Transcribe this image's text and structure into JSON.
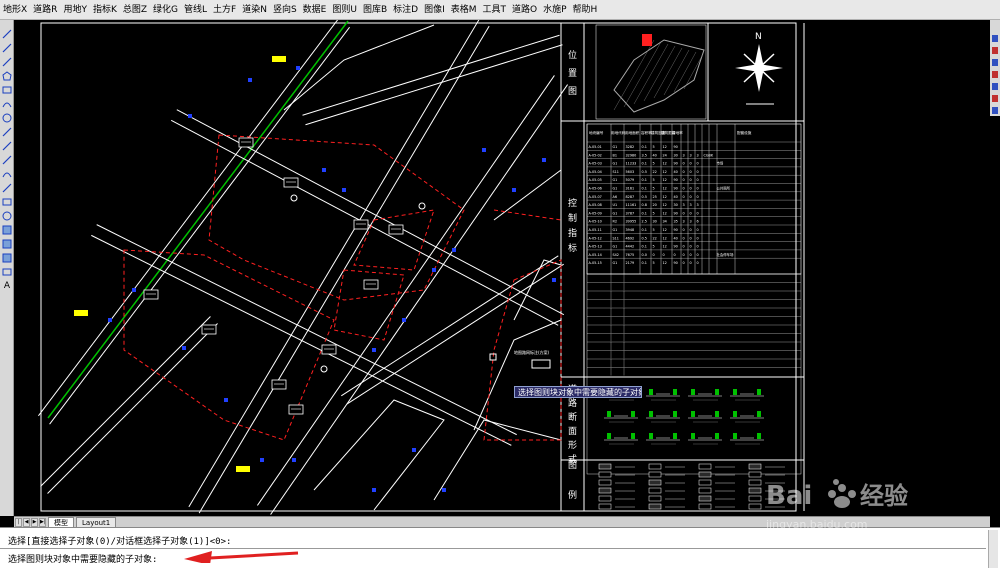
{
  "menu": {
    "items": [
      "地形X",
      "道路R",
      "用地Y",
      "指标K",
      "总图Z",
      "绿化G",
      "管线L",
      "土方F",
      "道染N",
      "竖向S",
      "数据E",
      "图则U",
      "图库B",
      "标注D",
      "图像I",
      "表格M",
      "工具T",
      "道路O",
      "水施P",
      "帮助H"
    ]
  },
  "drawing": {
    "map_titles": {
      "location": [
        "位",
        "置",
        "图"
      ],
      "indicators": [
        "控",
        "制",
        "指",
        "标"
      ],
      "road_section": [
        "道",
        "路",
        "断",
        "面",
        "形",
        "式"
      ],
      "legend": [
        "图",
        "例"
      ]
    },
    "north_label": "N",
    "table_headers": [
      "地块编号",
      "用地代码",
      "用地面积",
      "容积率",
      "建筑密度",
      "建筑限高",
      "绿地率",
      "配套设施"
    ],
    "table_rows": [
      [
        "A-05-01",
        "G1",
        "3282",
        "0.1",
        "5",
        "12",
        "90",
        "",
        ""
      ],
      [
        "A-05-02",
        "B1",
        "32980",
        "3.5",
        "40",
        "24",
        "30",
        "3",
        "3",
        "3",
        "CGBK",
        ""
      ],
      [
        "A-05-03",
        "G1",
        "11233",
        "0.1",
        "5",
        "12",
        "90",
        "0",
        "0",
        "0",
        "",
        "市场"
      ],
      [
        "A-05-04",
        "S11",
        "5603",
        "0.5",
        "22",
        "12",
        "40",
        "0",
        "0",
        "0",
        "",
        ""
      ],
      [
        "A-05-05",
        "G1",
        "5079",
        "0.1",
        "5",
        "12",
        "90",
        "0",
        "0",
        "0",
        "",
        ""
      ],
      [
        "A-05-06",
        "G1",
        "3161",
        "0.1",
        "5",
        "12",
        "90",
        "0",
        "0",
        "0",
        "",
        "公共厕所"
      ],
      [
        "A-05-07",
        "A6",
        "8287",
        "0.5",
        "25",
        "12",
        "40",
        "0",
        "0",
        "0",
        "",
        ""
      ],
      [
        "A-05-08",
        "U1",
        "11161",
        "0.8",
        "20",
        "12",
        "30",
        "3",
        "3",
        "3",
        "",
        ""
      ],
      [
        "A-05-09",
        "G1",
        "3787",
        "0.1",
        "5",
        "12",
        "90",
        "0",
        "0",
        "0",
        "",
        ""
      ],
      [
        "A-05-10",
        "R2",
        "39955",
        "2.5",
        "30",
        "34",
        "35",
        "3",
        "3",
        "6",
        "",
        ""
      ],
      [
        "A-05-11",
        "G1",
        "3948",
        "0.1",
        "5",
        "12",
        "90",
        "0",
        "0",
        "0",
        "",
        ""
      ],
      [
        "A-05-12",
        "S11",
        "4692",
        "0.5",
        "22",
        "12",
        "40",
        "0",
        "0",
        "0",
        "",
        ""
      ],
      [
        "A-05-13",
        "G1",
        "4442",
        "0.1",
        "5",
        "12",
        "90",
        "0",
        "0",
        "0",
        "",
        ""
      ],
      [
        "A-05-14",
        "S42",
        "7675",
        "0.0",
        "0",
        "0",
        "0",
        "0",
        "0",
        "0",
        "",
        "社会停车场"
      ],
      [
        "A-05-15",
        "G1",
        "2179",
        "0.1",
        "5",
        "12",
        "90",
        "0",
        "0",
        "0",
        "",
        ""
      ]
    ],
    "map_annotation": "地图路网标注(方案)"
  },
  "tooltip": "选择图则块对象中需要隐藏的子对象:",
  "tabs": {
    "nav": [
      "|◀",
      "◀",
      "▶",
      "▶|"
    ],
    "model": "模型",
    "layout": "Layout1"
  },
  "command": {
    "line1": "选择[直接选择子对象(0)/对话框选择子对象(1)]<0>:",
    "line2": "选择图则块对象中需要隐藏的子对象:"
  },
  "watermark": {
    "brand_en": "Bai",
    "brand_cn": "经验",
    "site": "jingyan.baidu.com"
  },
  "colors": {
    "cad_bg": "#000000",
    "road": "#ffffff",
    "boundary": "#ff2020",
    "green": "#00c000",
    "blue": "#2040ff",
    "tooltip_bg": "#2b2b66",
    "arrow": "#e02020"
  }
}
